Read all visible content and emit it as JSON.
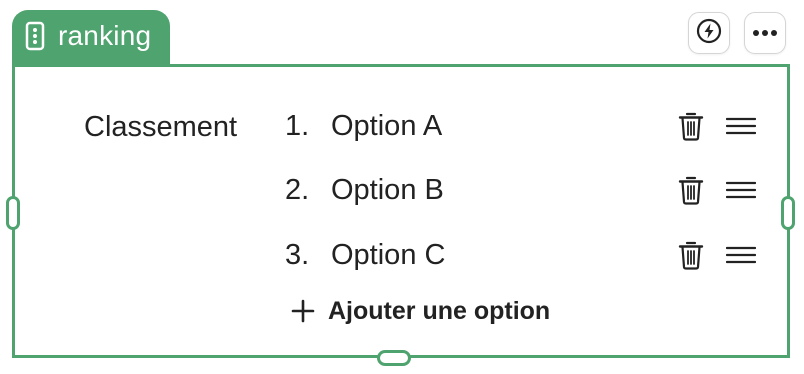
{
  "tag": {
    "label": "ranking",
    "icon": "grip-dots-icon"
  },
  "actions": [
    {
      "name": "bolt",
      "icon": "bolt-icon"
    },
    {
      "name": "more",
      "icon": "more-dots-icon"
    }
  ],
  "field": {
    "label": "Classement"
  },
  "options": [
    {
      "number": "1.",
      "text": "Option A"
    },
    {
      "number": "2.",
      "text": "Option B"
    },
    {
      "number": "3.",
      "text": "Option C"
    }
  ],
  "add_option": {
    "label": "Ajouter une option",
    "icon": "plus-icon"
  },
  "colors": {
    "accent": "#4fa36f",
    "text": "#222222"
  }
}
